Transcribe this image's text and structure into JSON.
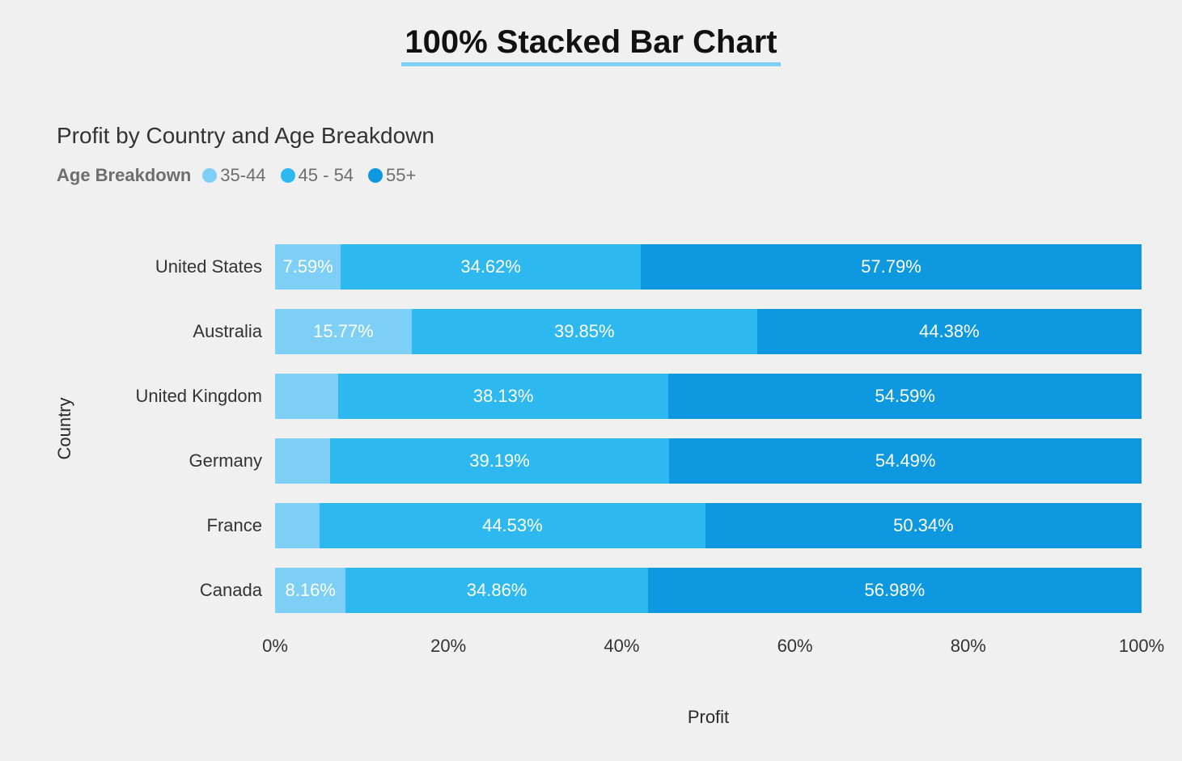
{
  "title": "100% Stacked Bar Chart",
  "subtitle": "Profit by Country and Age Breakdown",
  "legend_title": "Age Breakdown",
  "xaxis_title": "Profit",
  "yaxis_title": "Country",
  "colors": {
    "s0": "#7ecff5",
    "s1": "#2eb8f0",
    "s2": "#0d98e0"
  },
  "legend": [
    {
      "label": "35-44",
      "color": "#7ecff5"
    },
    {
      "label": "45 - 54",
      "color": "#2eb8f0"
    },
    {
      "label": "55+",
      "color": "#0d98e0"
    }
  ],
  "xticks": [
    "0%",
    "20%",
    "40%",
    "60%",
    "80%",
    "100%"
  ],
  "rows": [
    {
      "country": "United States",
      "s0": {
        "v": 7.59,
        "label": "7.59%"
      },
      "s1": {
        "v": 34.62,
        "label": "34.62%"
      },
      "s2": {
        "v": 57.79,
        "label": "57.79%"
      }
    },
    {
      "country": "Australia",
      "s0": {
        "v": 15.77,
        "label": "15.77%"
      },
      "s1": {
        "v": 39.85,
        "label": "39.85%"
      },
      "s2": {
        "v": 44.38,
        "label": "44.38%"
      }
    },
    {
      "country": "United Kingdom",
      "s0": {
        "v": 7.28,
        "label": ""
      },
      "s1": {
        "v": 38.13,
        "label": "38.13%"
      },
      "s2": {
        "v": 54.59,
        "label": "54.59%"
      }
    },
    {
      "country": "Germany",
      "s0": {
        "v": 6.32,
        "label": ""
      },
      "s1": {
        "v": 39.19,
        "label": "39.19%"
      },
      "s2": {
        "v": 54.49,
        "label": "54.49%"
      }
    },
    {
      "country": "France",
      "s0": {
        "v": 5.13,
        "label": ""
      },
      "s1": {
        "v": 44.53,
        "label": "44.53%"
      },
      "s2": {
        "v": 50.34,
        "label": "50.34%"
      }
    },
    {
      "country": "Canada",
      "s0": {
        "v": 8.16,
        "label": "8.16%"
      },
      "s1": {
        "v": 34.86,
        "label": "34.86%"
      },
      "s2": {
        "v": 56.98,
        "label": "56.98%"
      }
    }
  ],
  "chart_data": {
    "type": "bar",
    "stacked": "100%",
    "orientation": "horizontal",
    "title": "Profit by Country and Age Breakdown",
    "xlabel": "Profit",
    "ylabel": "Country",
    "xlim": [
      0,
      100
    ],
    "categories": [
      "United States",
      "Australia",
      "United Kingdom",
      "Germany",
      "France",
      "Canada"
    ],
    "series": [
      {
        "name": "35-44",
        "color": "#7ecff5",
        "values": [
          7.59,
          15.77,
          7.28,
          6.32,
          5.13,
          8.16
        ]
      },
      {
        "name": "45 - 54",
        "color": "#2eb8f0",
        "values": [
          34.62,
          39.85,
          38.13,
          39.19,
          44.53,
          34.86
        ]
      },
      {
        "name": "55+",
        "color": "#0d98e0",
        "values": [
          57.79,
          44.38,
          54.59,
          54.49,
          50.34,
          56.98
        ]
      }
    ]
  }
}
